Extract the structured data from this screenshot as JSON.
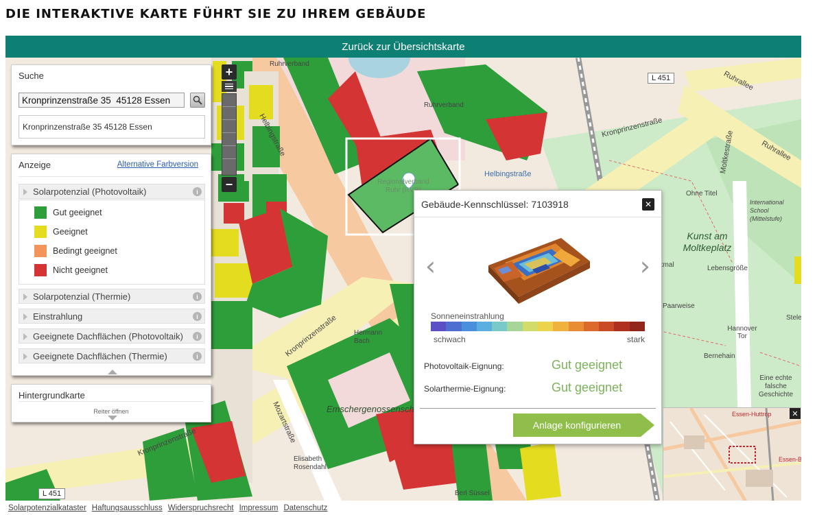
{
  "page": {
    "title": "DIE INTERAKTIVE KARTE FÜHRT SIE ZU IHREM GEBÄUDE"
  },
  "nav": {
    "back_label": "Zurück zur Übersichtskarte"
  },
  "search": {
    "header": "Suche",
    "value": "Kronprinzenstraße 35  45128 Essen",
    "result": "Kronprinzenstraße 35 45128 Essen"
  },
  "display": {
    "header": "Anzeige",
    "alt_link": "Alternative Farbversion",
    "layers": [
      {
        "label": "Solarpotenzial (Photovoltaik)"
      },
      {
        "label": "Solarpotenzial (Thermie)"
      },
      {
        "label": "Einstrahlung"
      },
      {
        "label": "Geeignete Dachflächen (Photovoltaik)"
      },
      {
        "label": "Geeignete Dachflächen (Thermie)"
      }
    ],
    "legend": [
      {
        "label": "Gut geeignet",
        "color": "#2e9e3a"
      },
      {
        "label": "Geeignet",
        "color": "#e4dc1f"
      },
      {
        "label": "Bedingt geeignet",
        "color": "#f1955a"
      },
      {
        "label": "Nicht geeignet",
        "color": "#d53434"
      }
    ]
  },
  "background_map": {
    "header": "Hintergrundkarte",
    "open_label": "Reiter öffnen"
  },
  "popup": {
    "title": "Gebäude-Kennschlüssel: 7103918",
    "gradient_label": "Sonneneinstrahlung",
    "gradient_low": "schwach",
    "gradient_high": "stark",
    "gradient_colors": [
      "#5a4fc4",
      "#4e6fd1",
      "#4a8fdc",
      "#5aaee0",
      "#79c9c9",
      "#a6d69a",
      "#d2dc6a",
      "#edd34c",
      "#f0b23c",
      "#e98d34",
      "#dc6a2c",
      "#c94a25",
      "#b03020",
      "#93261a"
    ],
    "pv_label": "Photovoltaik-Eignung:",
    "pv_value": "Gut geeignet",
    "st_label": "Solarthermie-Eignung:",
    "st_value": "Gut geeignet",
    "configure_label": "Anlage konfigurieren"
  },
  "map_labels": {
    "ruhrverband_1": "Ruhrverband",
    "ruhrverband_2": "Ruhrverband",
    "helbingstrasse_1": "Helbingstraße",
    "helbingstrasse_2": "Helbingstraße",
    "kronprinzenstrasse_1": "Kronprinzenstraße",
    "kronprinzenstrasse_2": "Kronprinzenstraße",
    "kronprinzenstrasse_3": "Kronprinzenstraße",
    "ruhrallee_1": "Ruhrallee",
    "ruhrallee_2": "Ruhrallee",
    "moltkestrasse": "Moltkestraße",
    "mozartstrasse": "Mozartstraße",
    "kunst": "Kunst am Moltkeplatz",
    "ohne_titel": "Ohne Titel",
    "international_school": "International School (Mittelstufe)",
    "lebensgrosse": "Lebensgröße",
    "paarweise": "Paarweise",
    "hannover_tor": "Hannover Tor",
    "bernehain": "Bernehain",
    "eine_echte": "Eine echte falsche Geschichte",
    "emschergenossenschaft": "Emschergenossenschaft",
    "hermann": "Hermann Bach",
    "elisabeth": "Elisabeth Rosendahl",
    "berl": "Berl Süssel",
    "regionalverband": "Regionalverband Ruhr (RVR)",
    "nkmal": "nkmal",
    "stele": "Stele",
    "road_l451_top": "L 451",
    "road_l451_bottom": "L 451",
    "essen_huttrop": "Essen-Huttrop",
    "essen_be": "Essen-Be"
  },
  "footer": {
    "links": [
      "Solarpotenzialkataster",
      "Haftungsausschluss",
      "Widerspruchsrecht",
      "Impressum",
      "Datenschutz"
    ]
  }
}
